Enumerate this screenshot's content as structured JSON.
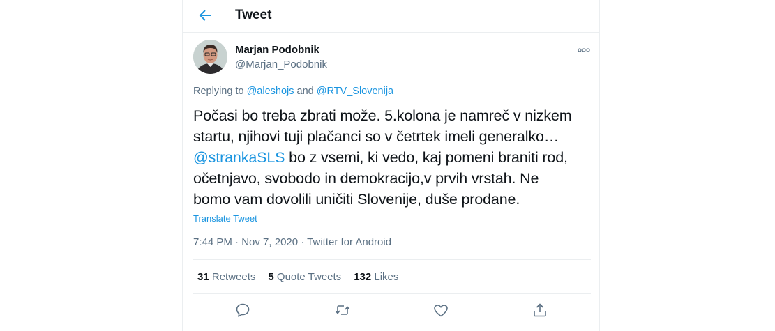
{
  "header": {
    "title": "Tweet",
    "back_icon": "back-arrow-icon"
  },
  "author": {
    "name": "Marjan Podobnik",
    "handle": "@Marjan_Podobnik",
    "avatar": "avatar-photo"
  },
  "reply": {
    "prefix": "Replying to ",
    "user1": "@aleshojs",
    "conj": " and ",
    "user2": "@RTV_Slovenija"
  },
  "tweet": {
    "line1": "Počasi bo treba  zbrati može. 5.kolona je namreč v nizkem",
    "line2": "startu, njihovi tuji plačanci so v četrtek imeli generalko…",
    "mention": "@strankaSLS",
    "line3_rest": " bo z vsemi, ki vedo, kaj pomeni braniti rod,",
    "line4": "očetnjavo, svobodo in demokracijo,v prvih vrstah. Ne",
    "line5": "bomo vam dovolili uničiti Slovenije, duše prodane."
  },
  "translate_label": "Translate Tweet",
  "meta": {
    "time": "7:44 PM",
    "sep": " · ",
    "date": "Nov 7, 2020",
    "source": "Twitter for Android"
  },
  "stats": {
    "retweets_count": "31",
    "retweets_label": " Retweets",
    "quotes_count": "5",
    "quotes_label": " Quote Tweets",
    "likes_count": "132",
    "likes_label": " Likes"
  },
  "colors": {
    "accent": "#1b95e0",
    "secondary_text": "#5b7083",
    "border": "#ebeef0"
  },
  "icons": [
    "back-arrow-icon",
    "more-icon",
    "reply-icon",
    "retweet-icon",
    "like-icon",
    "share-icon"
  ]
}
